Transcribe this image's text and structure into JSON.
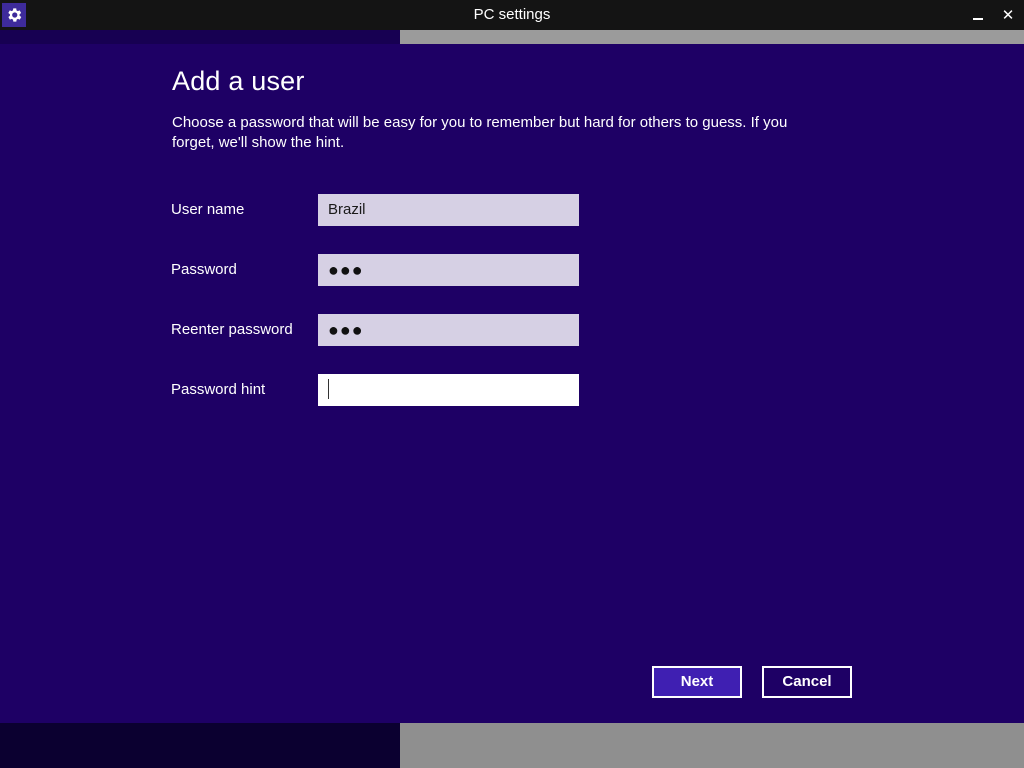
{
  "window": {
    "title": "PC settings",
    "app_icon": "gear-icon",
    "minimize_icon": "minimize-icon",
    "close_icon": "close-icon",
    "close_glyph": "✕"
  },
  "page": {
    "title": "Add a user",
    "description": "Choose a password that will be easy for you to remember but hard for others to guess. If you forget, we'll show the hint."
  },
  "form": {
    "fields": [
      {
        "label": "User name",
        "value": "Brazil",
        "type": "text"
      },
      {
        "label": "Password",
        "value": "●●●",
        "type": "password"
      },
      {
        "label": "Reenter password",
        "value": "●●●",
        "type": "password"
      },
      {
        "label": "Password hint",
        "value": "",
        "type": "text",
        "focused": true
      }
    ]
  },
  "buttons": {
    "next": "Next",
    "cancel": "Cancel"
  },
  "colors": {
    "panel_background": "#1e0065",
    "accent": "#3f1fb2",
    "input_background": "#d6d0e4",
    "input_focused_background": "#ffffff",
    "titlebar": "#141414"
  }
}
